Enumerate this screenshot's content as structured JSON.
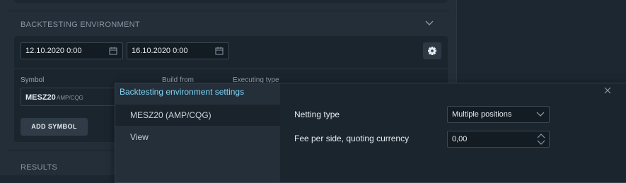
{
  "backtesting": {
    "section_title": "BACKTESTING ENVIRONMENT",
    "start_date": "12.10.2020 0:00",
    "end_date": "16.10.2020 0:00",
    "columns": {
      "symbol": "Symbol",
      "build_from": "Build from",
      "executing_type": "Executing type"
    },
    "symbol": {
      "name": "MESZ20",
      "exchange": "AMP/CQG"
    },
    "add_symbol_label": "ADD SYMBOL"
  },
  "results": {
    "section_title": "RESULTS"
  },
  "dialog": {
    "title": "Backtesting environment settings",
    "items": [
      {
        "label": "MESZ20 (AMP/CQG)",
        "active": true
      },
      {
        "label": "View",
        "active": false
      }
    ],
    "settings": {
      "netting_type_label": "Netting type",
      "netting_type_value": "Multiple positions",
      "fee_label": "Fee per side, quoting currency",
      "fee_value": "0,00"
    }
  },
  "colors": {
    "accent": "#7fd3f5",
    "background": "#1c2731",
    "panel": "#232e38"
  },
  "icons": [
    "chevron-down-icon",
    "calendar-icon",
    "gear-icon",
    "close-icon",
    "spinner-arrows-icon"
  ]
}
